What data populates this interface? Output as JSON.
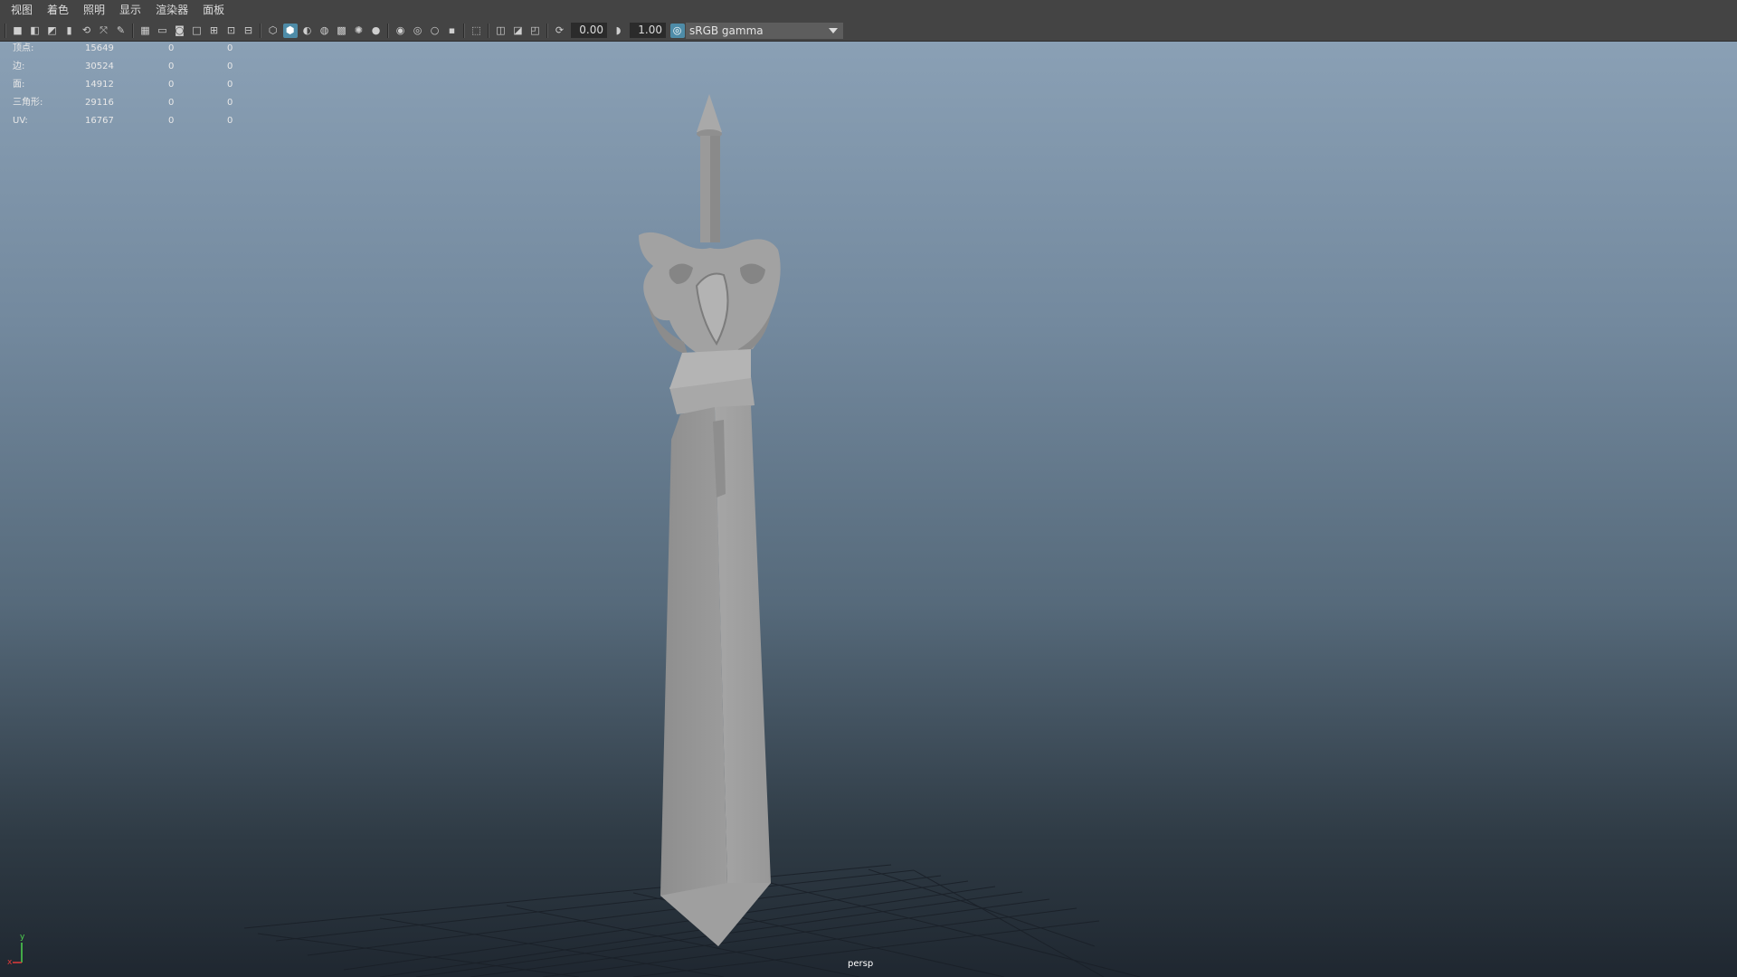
{
  "menu": {
    "items": [
      "视图",
      "着色",
      "照明",
      "显示",
      "渲染器",
      "面板"
    ]
  },
  "toolbar": {
    "exposure": "0.00",
    "gamma": "1.00",
    "color_space": "sRGB gamma"
  },
  "hud": {
    "rows": [
      {
        "label": "顶点:",
        "v1": "15649",
        "v2": "0",
        "v3": "0"
      },
      {
        "label": "边:",
        "v1": "30524",
        "v2": "0",
        "v3": "0"
      },
      {
        "label": "面:",
        "v1": "14912",
        "v2": "0",
        "v3": "0"
      },
      {
        "label": "三角形:",
        "v1": "29116",
        "v2": "0",
        "v3": "0"
      },
      {
        "label": "UV:",
        "v1": "16767",
        "v2": "0",
        "v3": "0"
      }
    ]
  },
  "viewport": {
    "camera_label": "persp",
    "axis_y": "y",
    "axis_x": "x"
  },
  "icons": [
    "camera-icon",
    "grid-icon",
    "wireframe-icon",
    "smooth-shade-icon",
    "lighting-icon",
    "isolate-icon",
    "gamma-icon",
    "exposure-icon",
    "color-management-icon"
  ],
  "colors": {
    "accent": "#4e8ca8",
    "axis_x": "#e03a3a",
    "axis_y": "#4ed44e"
  }
}
